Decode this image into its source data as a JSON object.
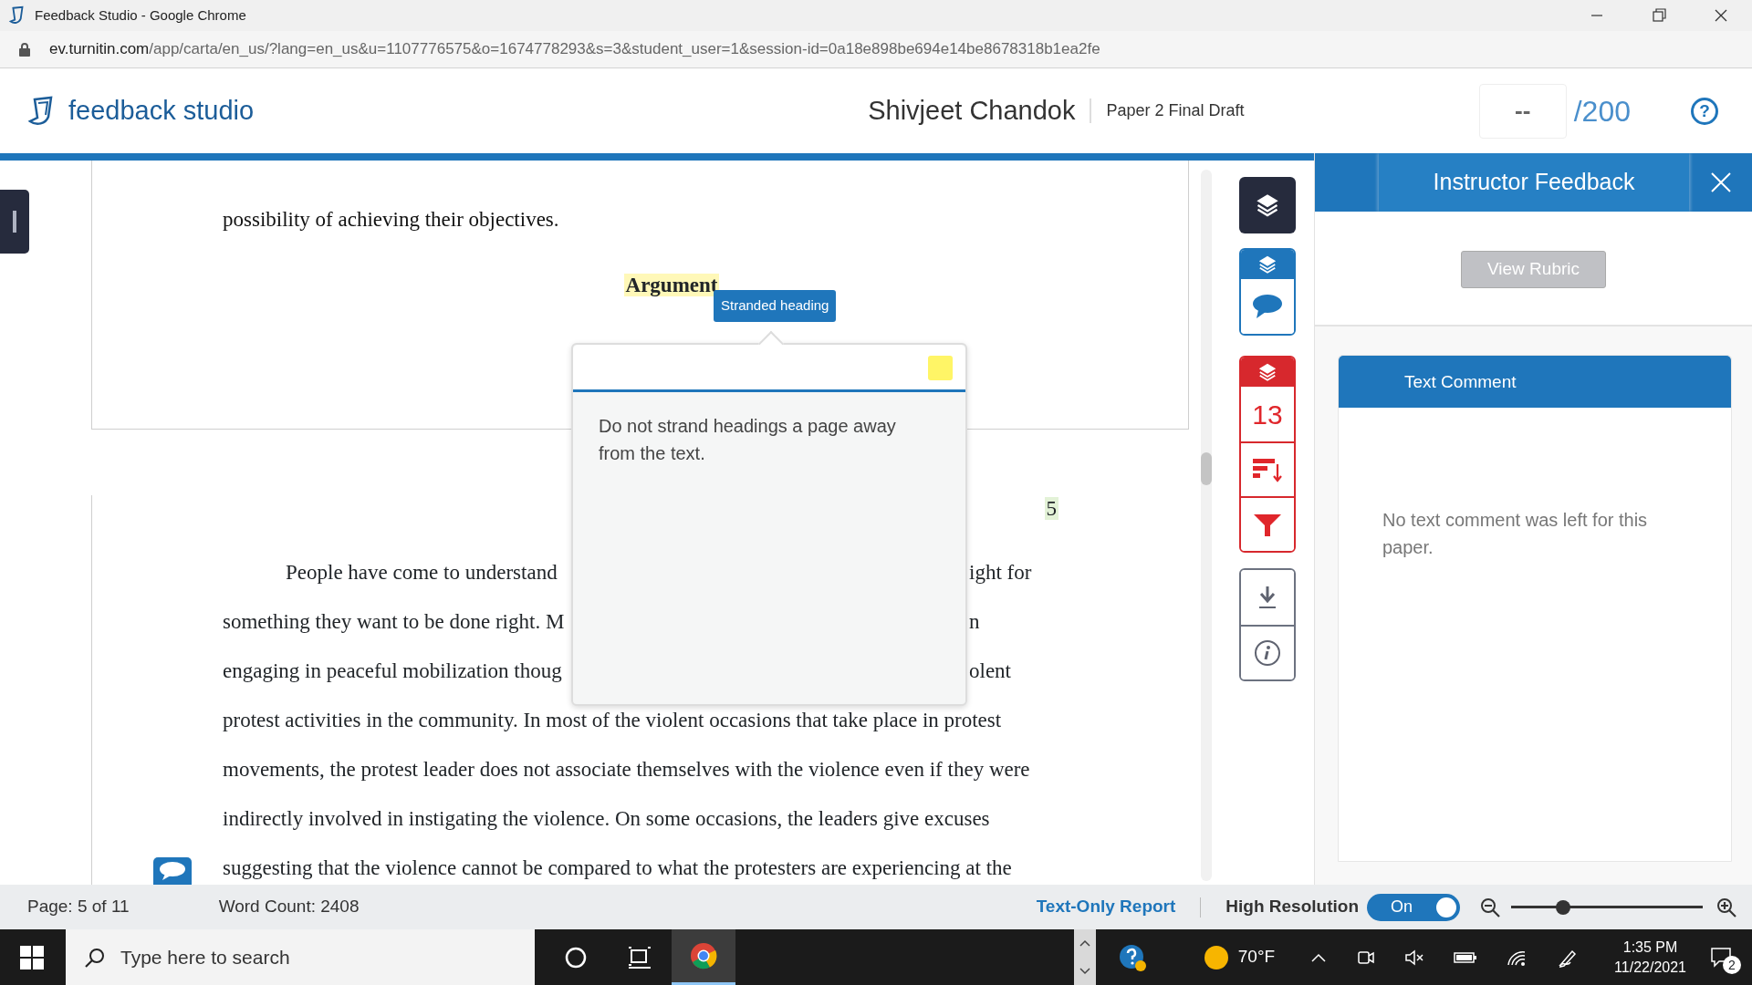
{
  "window": {
    "title": "Feedback Studio - Google Chrome"
  },
  "address_bar": {
    "host": "ev.turnitin.com",
    "path": "/app/carta/en_us/?lang=en_us&u=1107776575&o=1674778293&s=3&student_user=1&session-id=0a18e898be694e14be8678318b1ea2fe"
  },
  "header": {
    "logo": "feedback studio",
    "student": "Shivjeet Chandok",
    "assignment": "Paper 2 Final Draft",
    "score": "--",
    "max_score": "/200",
    "help": "?"
  },
  "document": {
    "page_lines": [
      "possibility of achieving their objectives."
    ],
    "heading": "Argument",
    "page_number": "5",
    "paragraph": [
      {
        "left": "People have come to understand",
        "right": "ight for",
        "indent": true
      },
      {
        "left": "something they want to be done right. M",
        "right": "n",
        "indent": false
      },
      {
        "left": "engaging in peaceful mobilization thoug",
        "right": "olent",
        "indent": false
      },
      {
        "left": "protest activities in the community. In most of the violent occasions that take place in protest",
        "indent": false
      },
      {
        "left": "movements, the protest leader does not associate themselves with the violence even if they were",
        "indent": false
      },
      {
        "left": "indirectly involved in instigating the violence. On some occasions, the leaders give excuses",
        "indent": false
      },
      {
        "left": "suggesting that the violence cannot be compared to what the protesters are experiencing at the",
        "indent": false
      }
    ]
  },
  "annotation": {
    "label": "Stranded heading",
    "comment": "Do not strand headings a page away from the text."
  },
  "toolbar": {
    "count": "13"
  },
  "panel": {
    "title": "Instructor Feedback",
    "rubric_button": "View Rubric",
    "card_title": "Text Comment",
    "card_text": "No text comment was left for this paper."
  },
  "status_bar": {
    "page": "Page: 5 of 11",
    "word_count": "Word Count: 2408",
    "report_link": "Text-Only Report",
    "resolution_label": "High Resolution",
    "toggle": {
      "label": "On",
      "on": true
    },
    "zoom": {
      "level": 0.27
    }
  },
  "taskbar": {
    "search_placeholder": "Type here to search",
    "apps": [
      {
        "kind": "cortana",
        "selected": false
      },
      {
        "kind": "taskview",
        "selected": false
      },
      {
        "kind": "chrome",
        "selected": true
      }
    ],
    "weather": "70°F",
    "time": "1:35 PM",
    "date": "11/22/2021",
    "notifications": "2"
  }
}
